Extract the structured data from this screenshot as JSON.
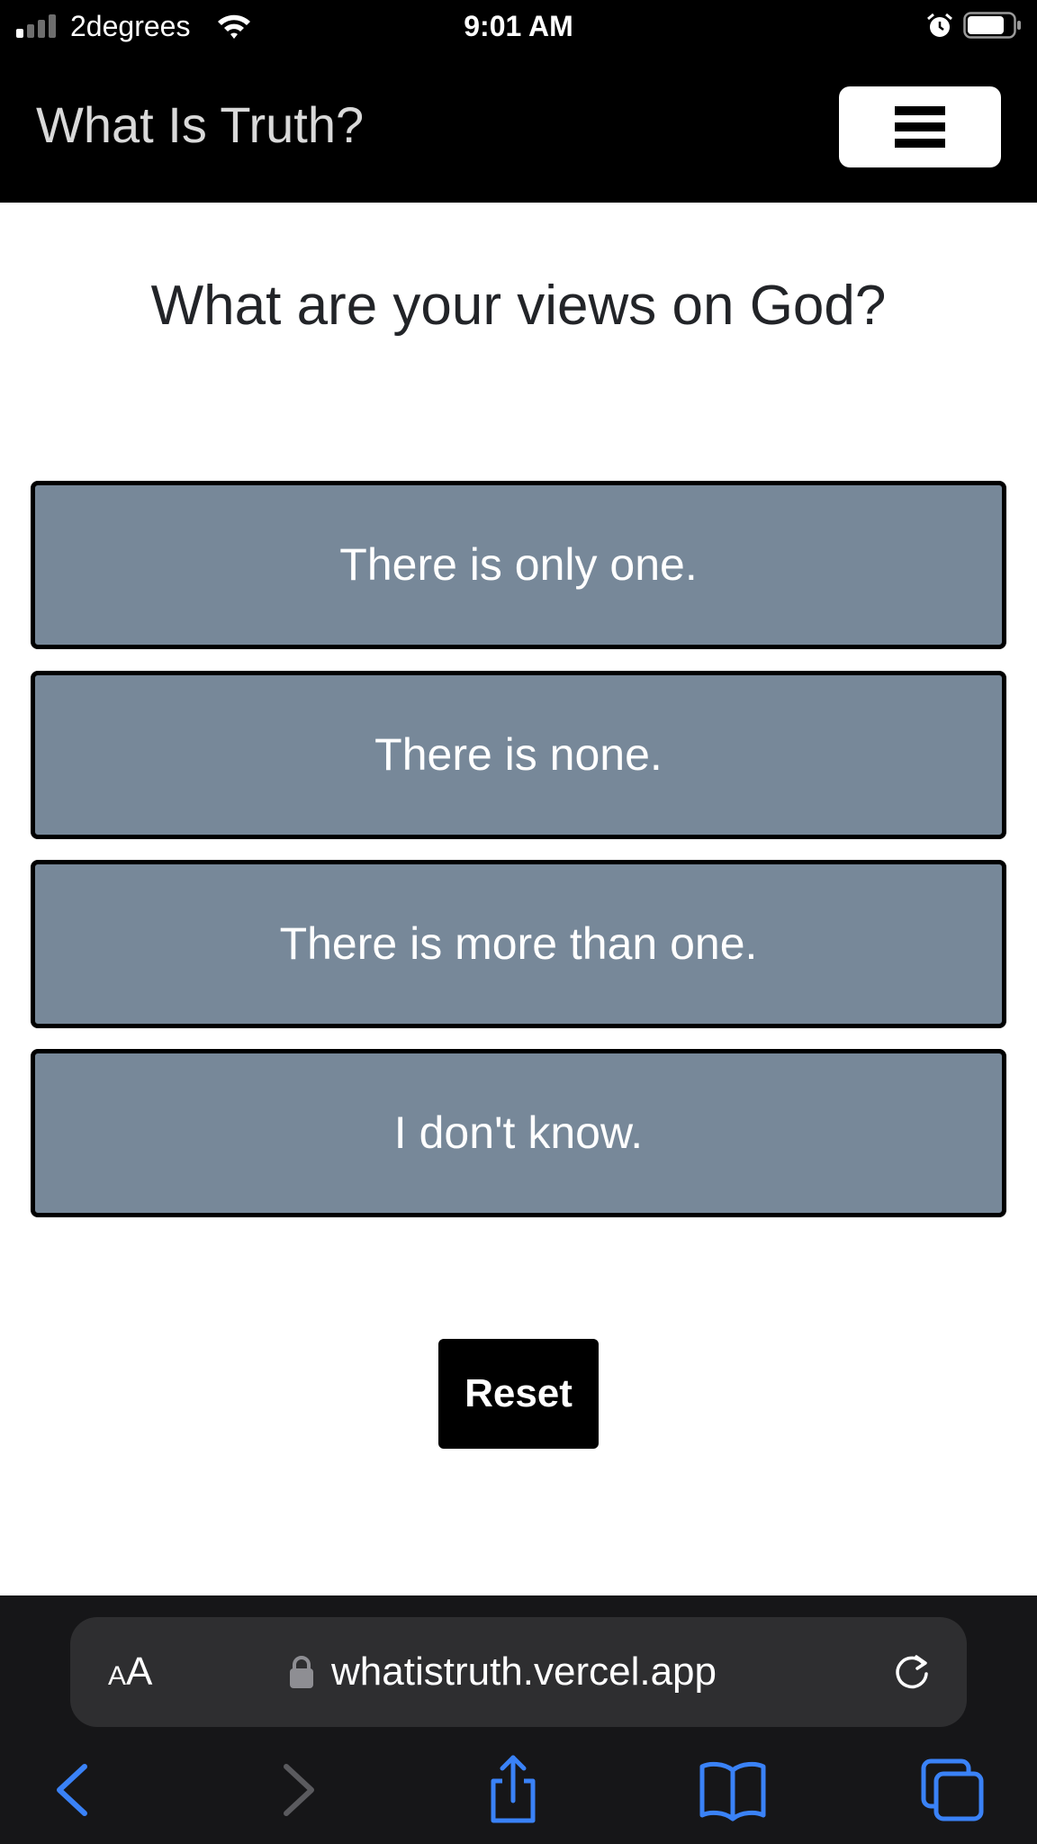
{
  "status_bar": {
    "carrier": "2degrees",
    "time": "9:01 AM",
    "signal_bars_active": 1,
    "icons": [
      "signal-icon",
      "wifi-icon",
      "alarm-icon",
      "battery-icon"
    ]
  },
  "navbar": {
    "brand": "What Is Truth?",
    "menu_icon": "hamburger-icon"
  },
  "main": {
    "question": "What are your views on God?",
    "answers": [
      "There is only one.",
      "There is none.",
      "There is more than one.",
      "I don't know."
    ],
    "reset_label": "Reset"
  },
  "browser": {
    "text_size_small": "A",
    "text_size_large": "A",
    "url": "whatistruth.vercel.app",
    "toolbar_icons": [
      "back-icon",
      "forward-icon",
      "share-icon",
      "bookmarks-icon",
      "tabs-icon"
    ]
  },
  "colors": {
    "navbar_bg": "#000000",
    "answer_bg": "#778899",
    "answer_border": "#000000",
    "reset_bg": "#000000",
    "browser_bg": "#161618",
    "browser_accent": "#3a82f7"
  }
}
